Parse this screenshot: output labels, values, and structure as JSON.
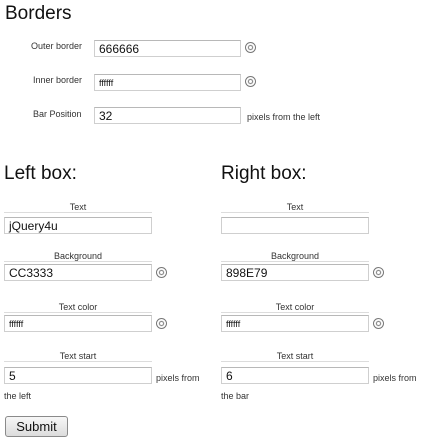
{
  "borders": {
    "title": "Borders",
    "outer_label": "Outer border",
    "outer_value": "666666",
    "inner_label": "Inner border",
    "inner_value": "ffffff",
    "bar_label": "Bar Position",
    "bar_value": "32",
    "bar_suffix": "pixels from the left"
  },
  "left_box": {
    "title": "Left box:",
    "text_label": "Text",
    "text_value": "jQuery4u",
    "bg_label": "Background",
    "bg_value": "CC3333",
    "color_label": "Text color",
    "color_value": "ffffff",
    "start_label": "Text start",
    "start_value": "5",
    "start_suffix_1": "pixels from",
    "start_suffix_2": "the left"
  },
  "right_box": {
    "title": "Right box:",
    "text_label": "Text",
    "text_value": "",
    "bg_label": "Background",
    "bg_value": "898E79",
    "color_label": "Text color",
    "color_value": "ffffff",
    "start_label": "Text start",
    "start_value": "6",
    "start_suffix_1": "pixels from",
    "start_suffix_2": "the bar"
  },
  "submit_label": "Submit",
  "icons": {
    "color_picker": "color-wheel-icon"
  }
}
